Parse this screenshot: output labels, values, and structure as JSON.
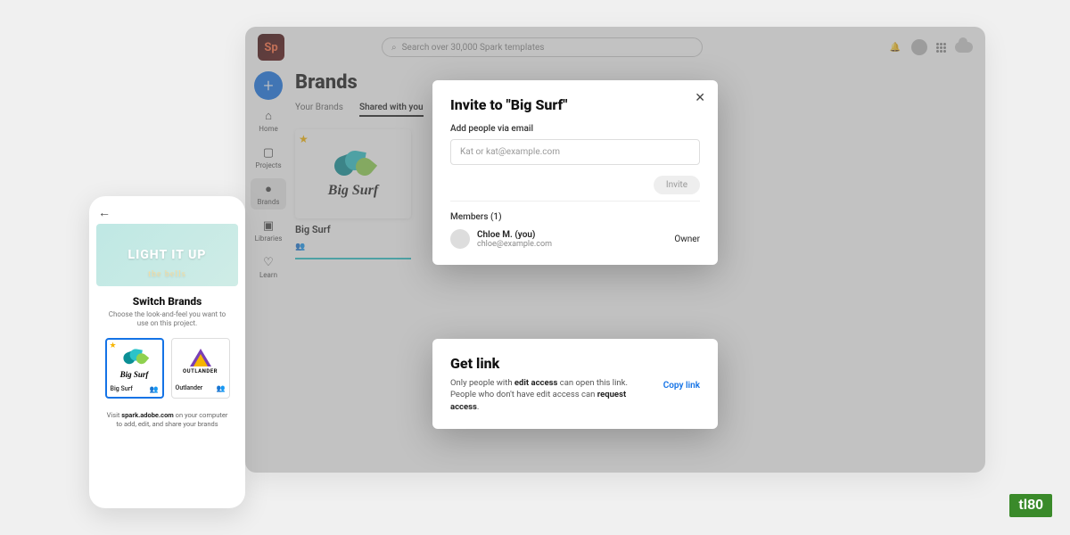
{
  "topbar": {
    "logo": "Sp",
    "search_placeholder": "Search over 30,000 Spark templates"
  },
  "rail": {
    "fab": "+",
    "items": [
      {
        "label": "Home"
      },
      {
        "label": "Projects"
      },
      {
        "label": "Brands"
      },
      {
        "label": "Libraries"
      },
      {
        "label": "Learn"
      }
    ]
  },
  "main": {
    "title": "Brands",
    "tabs": [
      "Your Brands",
      "Shared with you"
    ],
    "active_tab": 1,
    "brand_card": {
      "name": "Big Surf",
      "logo_text": "Big Surf"
    }
  },
  "invite_modal": {
    "title": "Invite to \"Big Surf\"",
    "add_label": "Add people via email",
    "placeholder": "Kat or kat@example.com",
    "invite_btn": "Invite",
    "members_header": "Members (1)",
    "member": {
      "name": "Chloe M. (you)",
      "email": "chloe@example.com",
      "role": "Owner"
    }
  },
  "getlink_modal": {
    "title": "Get link",
    "line1a": "Only people with ",
    "line1b": "edit access",
    "line1c": " can open this link.",
    "line2a": "People who don't have edit access can ",
    "line2b": "request access",
    "line2c": ".",
    "copy": "Copy link"
  },
  "phone": {
    "hero_title": "LIGHT IT UP",
    "hero_sub": "the bells",
    "title": "Switch Brands",
    "subtitle": "Choose the look-and-feel you want to use on this project.",
    "tiles": [
      {
        "name": "Big Surf",
        "logo_text": "Big Surf"
      },
      {
        "name": "Outlander",
        "logo_text": "OUTLANDER"
      }
    ],
    "footer_a": "Visit ",
    "footer_b": "spark.adobe.com",
    "footer_c": " on your computer to add, edit, and share your brands"
  },
  "badge": "tl80"
}
